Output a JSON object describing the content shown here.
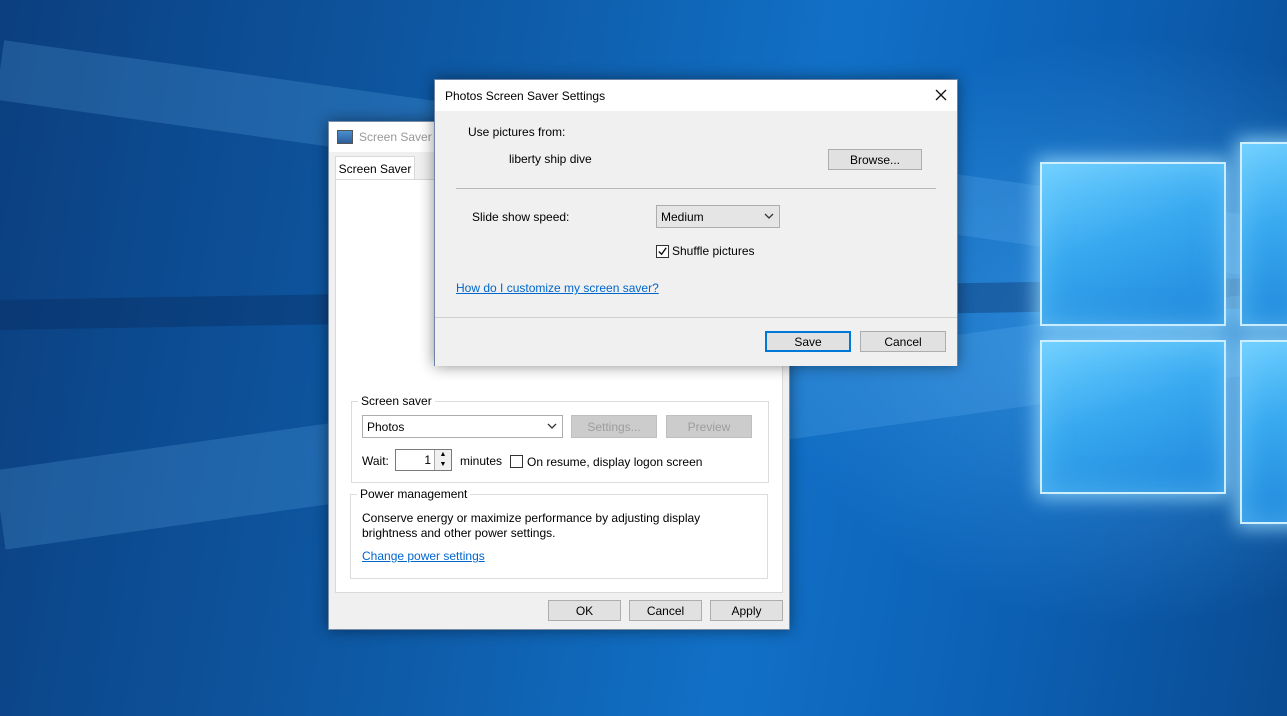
{
  "back_dialog": {
    "title": "Screen Saver Settings",
    "tab_label": "Screen Saver",
    "screen_saver_group": "Screen saver",
    "screen_saver_selected": "Photos",
    "settings_label": "Settings...",
    "preview_label": "Preview",
    "wait_label": "Wait:",
    "wait_value": "1",
    "minutes_label": "minutes",
    "on_resume_label": "On resume, display logon screen",
    "power_group": "Power management",
    "power_description": "Conserve energy or maximize performance by adjusting display brightness and other power settings.",
    "power_link": "Change power settings",
    "ok_label": "OK",
    "cancel_label": "Cancel",
    "apply_label": "Apply"
  },
  "photos_dialog": {
    "title": "Photos Screen Saver Settings",
    "use_pictures_label": "Use pictures from:",
    "folder_name": "liberty ship dive",
    "browse_label": "Browse...",
    "speed_label": "Slide show speed:",
    "speed_selected": "Medium",
    "shuffle_label": "Shuffle pictures",
    "shuffle_checked": true,
    "help_link": "How do I customize my screen saver?",
    "save_label": "Save",
    "cancel_label": "Cancel"
  },
  "icons": {
    "close": "close-icon",
    "dropdown": "chevron-down-icon",
    "app": "screen-saver-app-icon",
    "spin_up": "spin-up-icon",
    "spin_down": "spin-down-icon"
  },
  "colors": {
    "accent": "#0078d7",
    "link": "#0066cc",
    "desktop": "#0a4f93"
  }
}
